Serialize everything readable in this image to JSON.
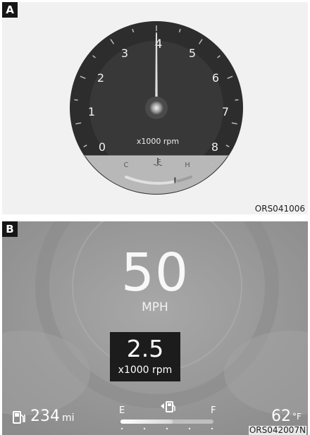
{
  "panel_a": {
    "label": "A",
    "code": "ORS041006",
    "tachometer": {
      "ticks": [
        "0",
        "1",
        "2",
        "3",
        "4",
        "5",
        "6",
        "7",
        "8"
      ],
      "unit": "x1000 rpm",
      "needle_rpm": 4
    },
    "temperature_gauge": {
      "cold_label": "C",
      "hot_label": "H",
      "icon": "coolant-temperature-icon",
      "level": 0.75
    }
  },
  "panel_b": {
    "label": "B",
    "code": "ORS042007N",
    "speed": {
      "value": "50",
      "unit": "MPH"
    },
    "rpm": {
      "value": "2.5",
      "unit": "x1000 rpm"
    },
    "range": {
      "value": "234",
      "unit": "mi",
      "icon": "fuel-pump-icon"
    },
    "fuel_gauge": {
      "empty_label": "E",
      "full_label": "F",
      "icon": "fuel-pump-icon",
      "level": 0.75
    },
    "outside_temp": {
      "value": "62",
      "unit": "°F"
    }
  },
  "colors": {
    "dial_dark": "#2b2b2b",
    "dial_mid": "#3b3b3b",
    "temp_zone": "#b9b9b9",
    "panel_b_bg": "#9a9a9a"
  }
}
